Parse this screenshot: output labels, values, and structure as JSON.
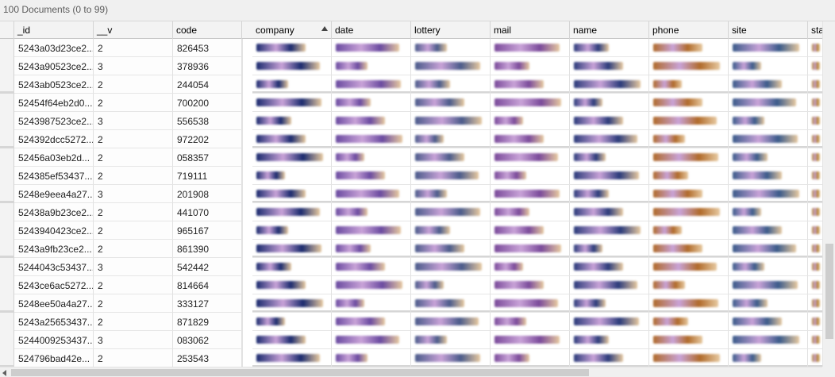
{
  "status": {
    "text": "100 Documents (0 to 99)"
  },
  "columns": [
    {
      "key": "id",
      "label": "_id"
    },
    {
      "key": "v",
      "label": "__v"
    },
    {
      "key": "code",
      "label": "code"
    },
    {
      "key": "company",
      "label": "company",
      "sorted": "ascending"
    },
    {
      "key": "date",
      "label": "date"
    },
    {
      "key": "lottery",
      "label": "lottery"
    },
    {
      "key": "mail",
      "label": "mail"
    },
    {
      "key": "name",
      "label": "name"
    },
    {
      "key": "phone",
      "label": "phone"
    },
    {
      "key": "site",
      "label": "site"
    },
    {
      "key": "sta",
      "label": "sta"
    }
  ],
  "rows": [
    {
      "id": "5243a03d23ce2...",
      "v": "2",
      "code": "826453"
    },
    {
      "id": "5243a90523ce2...",
      "v": "3",
      "code": "378936"
    },
    {
      "id": "5243ab0523ce2...",
      "v": "2",
      "code": "244054"
    },
    {
      "id": "52454f64eb2d0...",
      "v": "2",
      "code": "700200"
    },
    {
      "id": "5243987523ce2...",
      "v": "3",
      "code": "556538"
    },
    {
      "id": "524392dcc5272...",
      "v": "2",
      "code": "972202"
    },
    {
      "id": "52456a03eb2d...",
      "v": "2",
      "code": "058357"
    },
    {
      "id": "524385ef53437...",
      "v": "2",
      "code": "719111"
    },
    {
      "id": "5248e9eea4a27...",
      "v": "3",
      "code": "201908"
    },
    {
      "id": "52438a9b23ce2...",
      "v": "2",
      "code": "441070"
    },
    {
      "id": "5243940423ce2...",
      "v": "2",
      "code": "965167"
    },
    {
      "id": "5243a9fb23ce2...",
      "v": "2",
      "code": "861390"
    },
    {
      "id": "5244043c53437...",
      "v": "3",
      "code": "542442"
    },
    {
      "id": "5243ce6ac5272...",
      "v": "2",
      "code": "814664"
    },
    {
      "id": "5248ee50a4a27...",
      "v": "2",
      "code": "333127"
    },
    {
      "id": "5243a25653437...",
      "v": "2",
      "code": "871829"
    },
    {
      "id": "5244009253437...",
      "v": "3",
      "code": "083062"
    },
    {
      "id": "524796bad42e...",
      "v": "2",
      "code": "253543"
    }
  ],
  "blur_colors": {
    "company": "#1a2a6e",
    "date": "#6a4aa0",
    "lottery": "#4a5a8a",
    "mail": "#7a4a9a",
    "name": "#2a3a7a",
    "phone": "#b06a2a",
    "site": "#3a5a8a",
    "sta": "#b0802a"
  }
}
